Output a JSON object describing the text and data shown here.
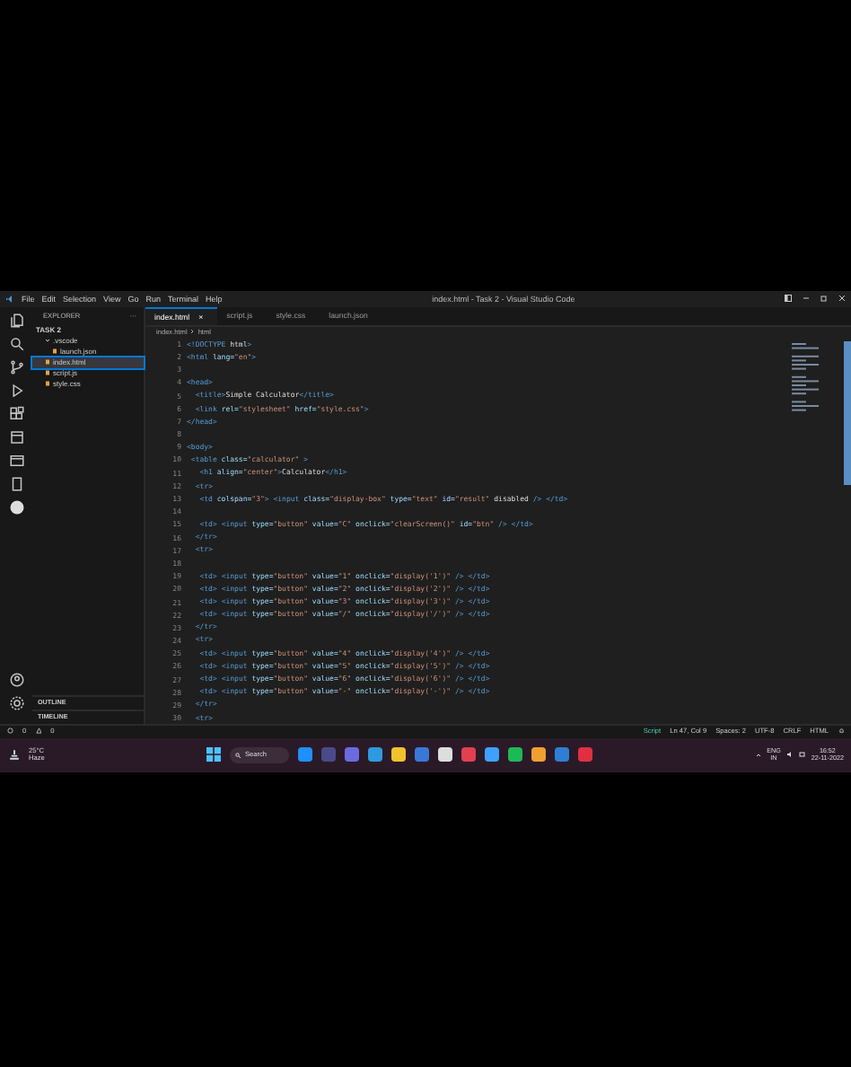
{
  "window": {
    "title": "index.html - Task 2 - Visual Studio Code"
  },
  "menu": [
    "File",
    "Edit",
    "Selection",
    "View",
    "Go",
    "Run",
    "Terminal",
    "Help"
  ],
  "tabs": [
    {
      "label": "index.html",
      "selected": true,
      "close": "×"
    },
    {
      "label": "script.js",
      "selected": false
    },
    {
      "label": "style.css",
      "selected": false
    },
    {
      "label": "launch.json",
      "selected": false
    }
  ],
  "sidebar": {
    "title": "EXPLORER",
    "more": "···",
    "folder": "TASK 2",
    "items": [
      {
        "label": ".vscode",
        "kind": "folder",
        "selected": false,
        "children": [
          {
            "label": "launch.json",
            "kind": "file",
            "selected": false
          }
        ]
      },
      {
        "label": "index.html",
        "kind": "file",
        "selected": true
      },
      {
        "label": "script.js",
        "kind": "file",
        "selected": false
      },
      {
        "label": "style.css",
        "kind": "file",
        "selected": false
      }
    ],
    "sections": [
      "OUTLINE",
      "TIMELINE"
    ]
  },
  "breadcrumb": [
    "index.html",
    "html"
  ],
  "editor": {
    "lines": [
      {
        "number": "1",
        "text": "<!DOCTYPE html>"
      },
      {
        "number": "2",
        "text": "<html lang=\"en\">"
      },
      {
        "number": "3"
      },
      {
        "number": "4",
        "text": "<head>"
      },
      {
        "number": "5",
        "text": "  <title>Simple Calculator</title>"
      },
      {
        "number": "6",
        "text": "  <link rel=\"stylesheet\" href=\"style.css\">"
      },
      {
        "number": "7",
        "text": "</head>"
      },
      {
        "number": "8"
      },
      {
        "number": "9",
        "text": "<body>"
      },
      {
        "number": "10",
        "text": " <table class=\"calculator\" >"
      },
      {
        "number": "11",
        "text": "   <h1 align=\"center\">Calculator</h1>"
      },
      {
        "number": "12",
        "text": "  <tr>"
      },
      {
        "number": "13",
        "text": "   <td colspan=\"3\"> <input class=\"display-box\" type=\"text\" id=\"result\" disabled /> </td>"
      },
      {
        "number": "14"
      },
      {
        "number": "15",
        "text": "   <td> <input type=\"button\" value=\"C\" onclick=\"clearScreen()\" id=\"btn\" /> </td>"
      },
      {
        "number": "16",
        "text": "  </tr>"
      },
      {
        "number": "17",
        "text": "  <tr>"
      },
      {
        "number": "18"
      },
      {
        "number": "19",
        "text": "   <td> <input type=\"button\" value=\"1\" onclick=\"display('1')\" /> </td>"
      },
      {
        "number": "20",
        "text": "   <td> <input type=\"button\" value=\"2\" onclick=\"display('2')\" /> </td>"
      },
      {
        "number": "21",
        "text": "   <td> <input type=\"button\" value=\"3\" onclick=\"display('3')\" /> </td>"
      },
      {
        "number": "22",
        "text": "   <td> <input type=\"button\" value=\"/\" onclick=\"display('/')\" /> </td>"
      },
      {
        "number": "23",
        "text": "  </tr>"
      },
      {
        "number": "24",
        "text": "  <tr>"
      },
      {
        "number": "25",
        "text": "   <td> <input type=\"button\" value=\"4\" onclick=\"display('4')\" /> </td>"
      },
      {
        "number": "26",
        "text": "   <td> <input type=\"button\" value=\"5\" onclick=\"display('5')\" /> </td>"
      },
      {
        "number": "27",
        "text": "   <td> <input type=\"button\" value=\"6\" onclick=\"display('6')\" /> </td>"
      },
      {
        "number": "28",
        "text": "   <td> <input type=\"button\" value=\"-\" onclick=\"display('-')\" /> </td>"
      },
      {
        "number": "29",
        "text": "  </tr>"
      },
      {
        "number": "30",
        "text": "  <tr>"
      }
    ]
  },
  "status_bar": {
    "errors": "0",
    "warnings": "0",
    "items": [
      "Script",
      "Ln 47, Col 9",
      "Spaces: 2",
      "UTF-8",
      "CRLF",
      "HTML"
    ]
  },
  "taskbar": {
    "weather": {
      "temp": "25°C",
      "condition": "Haze"
    },
    "search": "Search",
    "language": [
      "ENG",
      "IN"
    ],
    "time": "16:52",
    "date": "22-11-2022"
  }
}
